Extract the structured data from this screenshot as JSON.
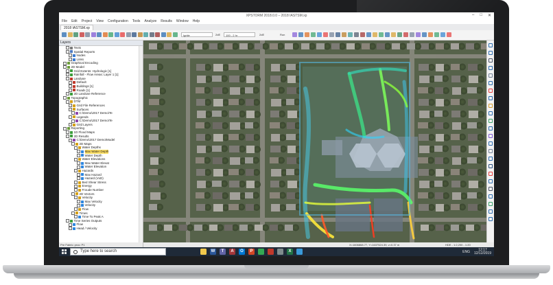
{
  "window": {
    "title": "XPSTORM 2018.0.0 – 2018 IASTSM.xp",
    "controls": [
      "–",
      "□",
      "✕"
    ]
  },
  "menu": [
    "File",
    "Edit",
    "Project",
    "View",
    "Configuration",
    "Tools",
    "Analyze",
    "Results",
    "Window",
    "Help"
  ],
  "document_tab": "2018 IASTSM.xp",
  "toolbar": {
    "combo1": "Ignite",
    "label_2d": "2dE",
    "combo2": "100 - 2 hr",
    "label_run": "Run"
  },
  "layers_panel": {
    "title": "Layers",
    "items": [
      {
        "label": "Texts",
        "depth": 2,
        "icon_color": "#7a7a7a"
      },
      {
        "label": "Spatial Reports",
        "depth": 2,
        "icon_color": "#4a78c0"
      },
      {
        "label": "Nodes",
        "depth": 3,
        "icon_color": "#3a7ad0"
      },
      {
        "label": "Links",
        "depth": 3,
        "icon_color": "#3a7ad0"
      },
      {
        "label": "Graphical Encoding",
        "depth": 1,
        "icon_color": "#6c9c3c"
      },
      {
        "label": "2D Model",
        "depth": 1,
        "icon_color": "#6c9c3c"
      },
      {
        "label": "Grid Extents: Hydrologic [1]",
        "depth": 2,
        "icon_color": "#3b9c3b"
      },
      {
        "label": "Rainfall - Flow Areas: Layer 1 [1]",
        "depth": 2,
        "icon_color": "#3b9c3b"
      },
      {
        "label": "Landuse",
        "depth": 2,
        "icon_color": "#c0392b"
      },
      {
        "label": "Default",
        "depth": 3,
        "icon_color": "#c0392b"
      },
      {
        "label": "Buildings [1]",
        "depth": 3,
        "icon_color": "#c0392b"
      },
      {
        "label": "Roads [1]",
        "depth": 3,
        "icon_color": "#c0392b"
      },
      {
        "label": "2D Landuse Reference",
        "depth": 2,
        "icon_color": "#3b9c3b"
      },
      {
        "label": "Topographic",
        "depth": 1,
        "icon_color": "#6c9c3c"
      },
      {
        "label": "DTM",
        "depth": 2,
        "icon_color": "#d4a017"
      },
      {
        "label": "Grid File References",
        "depth": 3,
        "icon_color": "#d4a017"
      },
      {
        "label": "Surfaces",
        "depth": 3,
        "icon_color": "#d4a017"
      },
      {
        "label": "C:\\Demo\\2017 Demo\\Te",
        "depth": 4,
        "icon_color": "#8e44ad"
      },
      {
        "label": "Legends",
        "depth": 3,
        "icon_color": "#d4a017"
      },
      {
        "label": "C:\\Demo\\2017 Demo\\Te",
        "depth": 4,
        "icon_color": "#8e44ad"
      },
      {
        "label": "Grid Layers",
        "depth": 3,
        "icon_color": "#d4a017"
      },
      {
        "label": "Reporting",
        "depth": 1,
        "icon_color": "#6c9c3c"
      },
      {
        "label": "1D Flood Maps",
        "depth": 2,
        "icon_color": "#3b9c3b"
      },
      {
        "label": "2D Results",
        "depth": 2,
        "icon_color": "#3b9c3b"
      },
      {
        "label": "C:\\Demo\\2017 Demo\\Model",
        "depth": 3,
        "icon_color": "#8e44ad"
      },
      {
        "label": "2D Maps",
        "depth": 4,
        "icon_color": "#d4a017"
      },
      {
        "label": "Water Depths",
        "depth": 5,
        "icon_color": "#d4a017"
      },
      {
        "label": "Max Water Depth",
        "depth": 6,
        "icon_color": "#2e86de",
        "highlight": true
      },
      {
        "label": "Water Depth",
        "depth": 6,
        "icon_color": "#2e86de"
      },
      {
        "label": "Water Elevations",
        "depth": 5,
        "icon_color": "#d4a017"
      },
      {
        "label": "Max Water Elevat",
        "depth": 6,
        "icon_color": "#2e86de"
      },
      {
        "label": "Water Elevation",
        "depth": 6,
        "icon_color": "#2e86de"
      },
      {
        "label": "Hazards",
        "depth": 5,
        "icon_color": "#d4a017"
      },
      {
        "label": "Max Hazard",
        "depth": 6,
        "icon_color": "#2e86de"
      },
      {
        "label": "Hazard (VxD)",
        "depth": 6,
        "icon_color": "#2e86de"
      },
      {
        "label": "Bed Shear Stress",
        "depth": 5,
        "icon_color": "#d4a017"
      },
      {
        "label": "Energy",
        "depth": 5,
        "icon_color": "#d4a017"
      },
      {
        "label": "Froude Number",
        "depth": 5,
        "icon_color": "#d4a017"
      },
      {
        "label": "2D Vectors",
        "depth": 4,
        "icon_color": "#d4a017"
      },
      {
        "label": "Velocity",
        "depth": 5,
        "icon_color": "#d4a017"
      },
      {
        "label": "Max Velocity",
        "depth": 6,
        "icon_color": "#2e86de"
      },
      {
        "label": "Velocity",
        "depth": 6,
        "icon_color": "#2e86de"
      },
      {
        "label": "Flow",
        "depth": 5,
        "icon_color": "#d4a017"
      },
      {
        "label": "Times",
        "depth": 4,
        "icon_color": "#d4a017"
      },
      {
        "label": "Time To Peak A",
        "depth": 5,
        "icon_color": "#2e86de"
      },
      {
        "label": "Time Series Outputs",
        "depth": 2,
        "icon_color": "#3b9c3b"
      },
      {
        "label": "Flow",
        "depth": 3,
        "icon_color": "#2e86de"
      },
      {
        "label": "Head / Velocity",
        "depth": 3,
        "icon_color": "#2e86de"
      }
    ],
    "footer": "Pre Fabric: proc: P1"
  },
  "status": {
    "coords": "X=1606868.77, Y=1637524.39, v=0.37 m",
    "mode": "HDE - 1:2,200 - 1:20"
  },
  "taskbar": {
    "search_placeholder": "Type here to search",
    "apps": [
      {
        "icon": "explorer-icon",
        "color": "#f2c94c",
        "glyph": ""
      },
      {
        "icon": "word-icon",
        "color": "#2b579a",
        "glyph": "W"
      },
      {
        "icon": "teams-icon",
        "color": "#6264a7",
        "glyph": "T"
      },
      {
        "icon": "access-icon",
        "color": "#a4373a",
        "glyph": "A"
      },
      {
        "icon": "outlook-icon",
        "color": "#0078d4",
        "glyph": "O"
      },
      {
        "icon": "powerpoint-icon",
        "color": "#d24726",
        "glyph": "P"
      },
      {
        "icon": "chrome-icon",
        "color": "#34a853",
        "glyph": ""
      },
      {
        "icon": "pdf-icon",
        "color": "#c0392b",
        "glyph": ""
      },
      {
        "icon": "file-icon",
        "color": "#7f8c8d",
        "glyph": ""
      },
      {
        "icon": "excel-icon",
        "color": "#217346",
        "glyph": "X"
      },
      {
        "icon": "xpswmm-icon",
        "color": "#3a9ad9",
        "glyph": ""
      }
    ],
    "language": "ENG",
    "time": "12:17",
    "date": "12/12/2019"
  }
}
